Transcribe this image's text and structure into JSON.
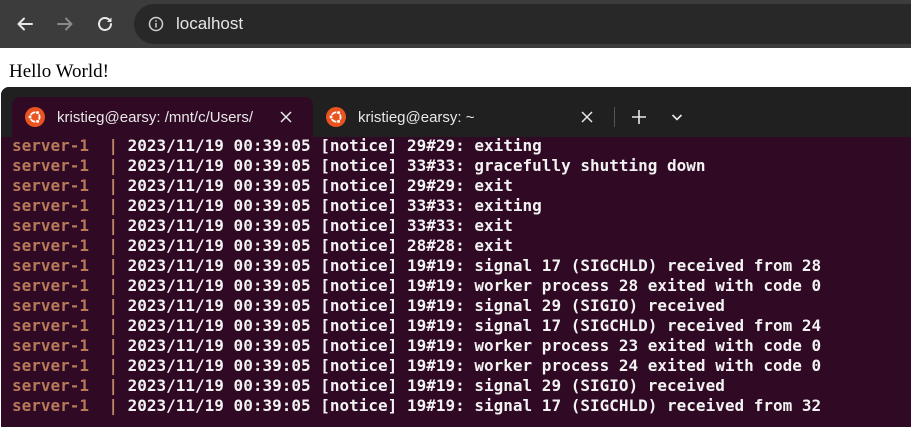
{
  "browser": {
    "url": "localhost",
    "icons": [
      "back-arrow-icon",
      "forward-arrow-icon",
      "reload-icon",
      "info-icon"
    ]
  },
  "page": {
    "text": "Hello World!"
  },
  "terminal": {
    "tabs": [
      {
        "label": "kristieg@earsy: /mnt/c/Users/",
        "icon": "ubuntu-icon",
        "active": true
      },
      {
        "label": "kristieg@earsy: ~",
        "icon": "ubuntu-icon",
        "active": false
      }
    ],
    "colors": {
      "background": "#300a24",
      "prefix": "#b8795a",
      "text": "#f2f2f2"
    },
    "lines": [
      {
        "prefix": "server-1",
        "msg": "2023/11/19 00:39:05 [notice] 29#29: exiting"
      },
      {
        "prefix": "server-1",
        "msg": "2023/11/19 00:39:05 [notice] 33#33: gracefully shutting down"
      },
      {
        "prefix": "server-1",
        "msg": "2023/11/19 00:39:05 [notice] 29#29: exit"
      },
      {
        "prefix": "server-1",
        "msg": "2023/11/19 00:39:05 [notice] 33#33: exiting"
      },
      {
        "prefix": "server-1",
        "msg": "2023/11/19 00:39:05 [notice] 33#33: exit"
      },
      {
        "prefix": "server-1",
        "msg": "2023/11/19 00:39:05 [notice] 28#28: exit"
      },
      {
        "prefix": "server-1",
        "msg": "2023/11/19 00:39:05 [notice] 19#19: signal 17 (SIGCHLD) received from 28"
      },
      {
        "prefix": "server-1",
        "msg": "2023/11/19 00:39:05 [notice] 19#19: worker process 28 exited with code 0"
      },
      {
        "prefix": "server-1",
        "msg": "2023/11/19 00:39:05 [notice] 19#19: signal 29 (SIGIO) received"
      },
      {
        "prefix": "server-1",
        "msg": "2023/11/19 00:39:05 [notice] 19#19: signal 17 (SIGCHLD) received from 24"
      },
      {
        "prefix": "server-1",
        "msg": "2023/11/19 00:39:05 [notice] 19#19: worker process 23 exited with code 0"
      },
      {
        "prefix": "server-1",
        "msg": "2023/11/19 00:39:05 [notice] 19#19: worker process 24 exited with code 0"
      },
      {
        "prefix": "server-1",
        "msg": "2023/11/19 00:39:05 [notice] 19#19: signal 29 (SIGIO) received"
      },
      {
        "prefix": "server-1",
        "msg": "2023/11/19 00:39:05 [notice] 19#19: signal 17 (SIGCHLD) received from 32"
      }
    ]
  }
}
